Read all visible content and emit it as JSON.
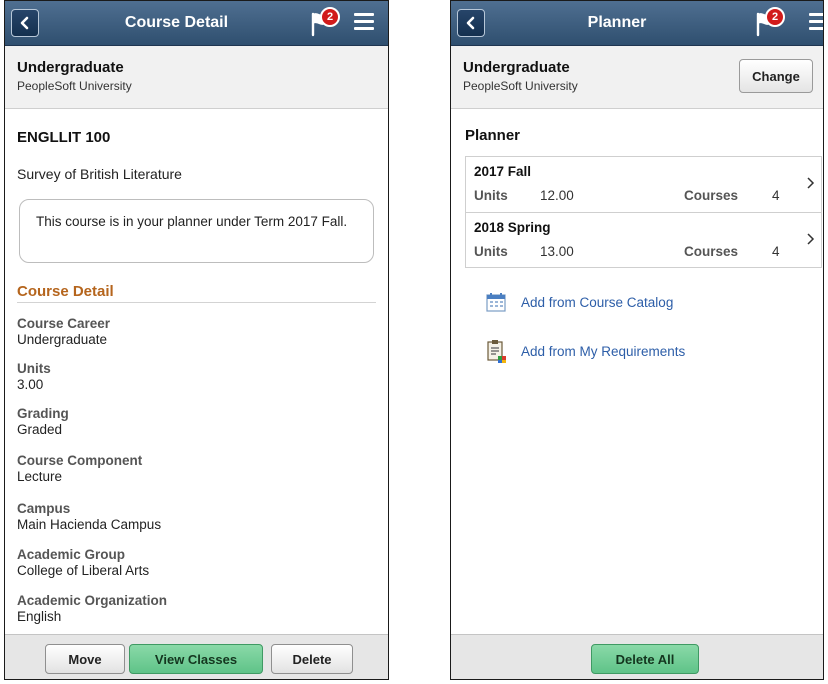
{
  "left": {
    "header": {
      "title": "Course Detail",
      "badge": "2"
    },
    "career": {
      "title": "Undergraduate",
      "institution": "PeopleSoft University"
    },
    "course": {
      "code": "ENGLLIT 100",
      "name": "Survey of British Literature",
      "planner_note": "This course is in your planner under Term 2017 Fall."
    },
    "section_title": "Course Detail",
    "details": [
      {
        "label": "Course Career",
        "value": "Undergraduate"
      },
      {
        "label": "Units",
        "value": "3.00"
      },
      {
        "label": "Grading",
        "value": "Graded"
      },
      {
        "label": "Course Component",
        "value": "Lecture"
      },
      {
        "label": "Campus",
        "value": "Main Hacienda Campus"
      },
      {
        "label": "Academic Group",
        "value": "College of Liberal Arts"
      },
      {
        "label": "Academic Organization",
        "value": "English"
      }
    ],
    "footer": {
      "move": "Move",
      "view_classes": "View Classes",
      "delete": "Delete"
    }
  },
  "right": {
    "header": {
      "title": "Planner",
      "badge": "2"
    },
    "career": {
      "title": "Undergraduate",
      "institution": "PeopleSoft University",
      "change": "Change"
    },
    "planner_title": "Planner",
    "terms": [
      {
        "name": "2017 Fall",
        "units_label": "Units",
        "units": "12.00",
        "courses_label": "Courses",
        "courses": "4"
      },
      {
        "name": "2018 Spring",
        "units_label": "Units",
        "units": "13.00",
        "courses_label": "Courses",
        "courses": "4"
      }
    ],
    "actions": [
      {
        "label": "Add from Course Catalog",
        "icon": "calendar-icon"
      },
      {
        "label": "Add from My Requirements",
        "icon": "clipboard-icon"
      }
    ],
    "footer": {
      "delete_all": "Delete All"
    }
  },
  "colors": {
    "banner": "#2f4f6f",
    "section_title": "#b5651d",
    "green_button": "#5fc388",
    "link": "#2d5ea8",
    "badge": "#d11b1b"
  }
}
